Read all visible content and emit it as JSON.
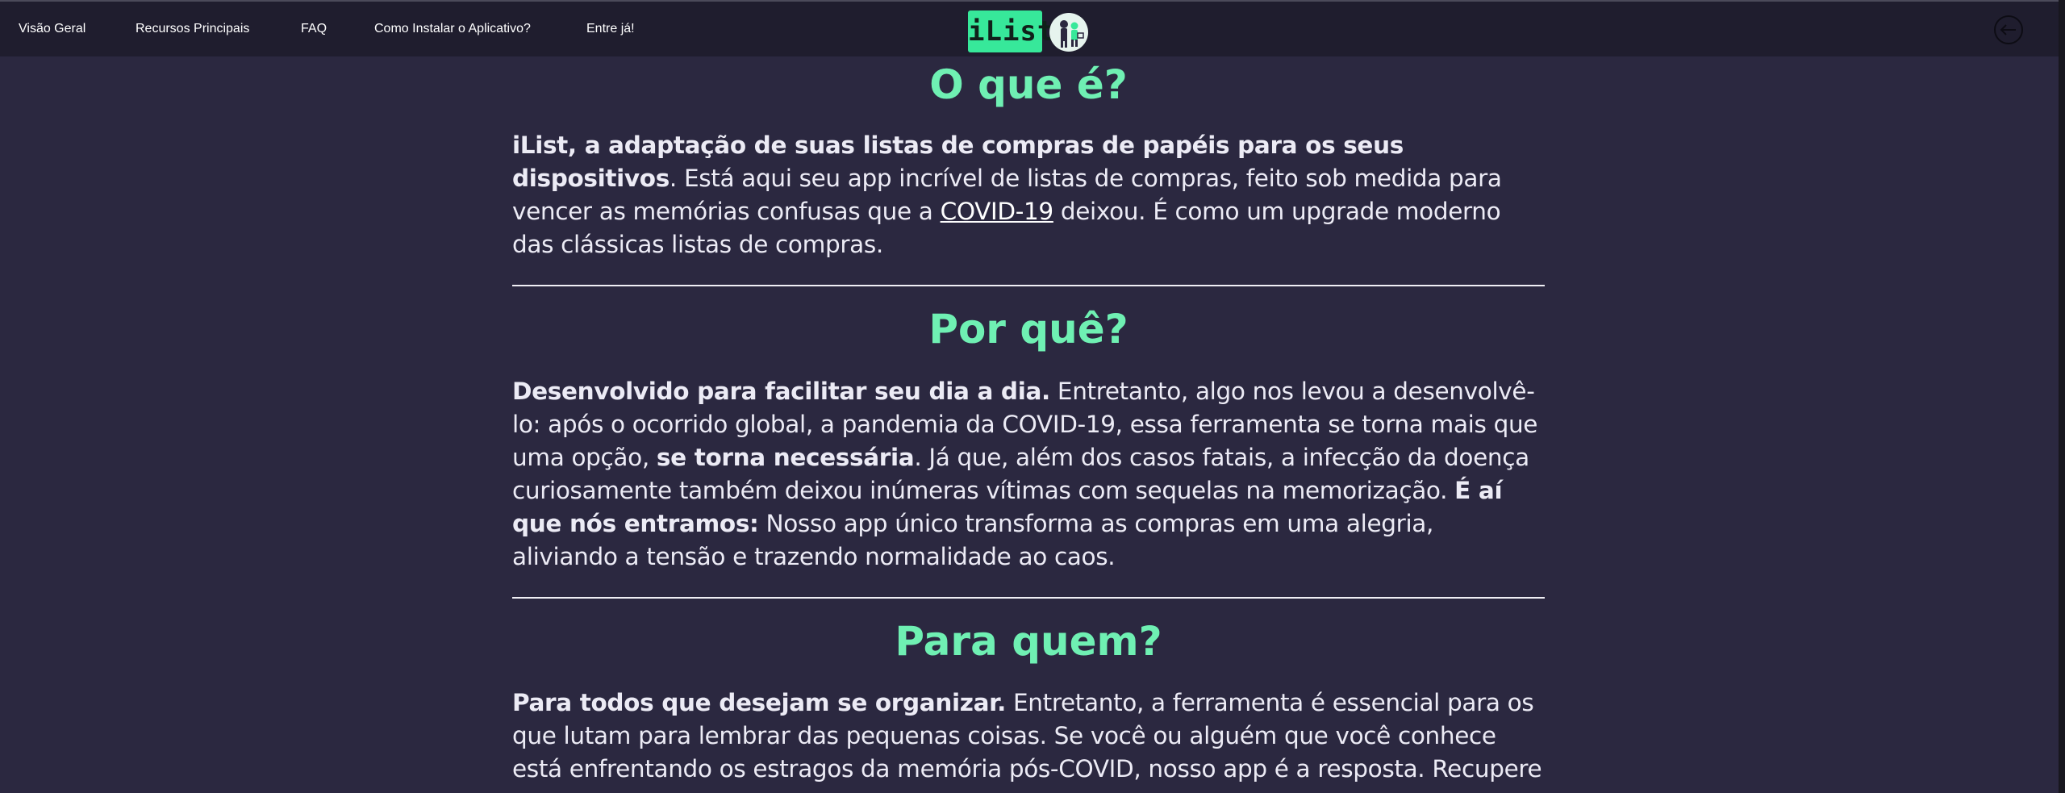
{
  "nav": {
    "items": [
      {
        "label": "Visão Geral"
      },
      {
        "label": "Recursos Principais"
      },
      {
        "label": "FAQ"
      },
      {
        "label": "Como Instalar o Aplicativo?"
      },
      {
        "label": "Entre já!"
      }
    ]
  },
  "brand": {
    "name": "iList",
    "logo_icon": "people-shopping-illustration-icon"
  },
  "back_icon": "arrow-left-circle-icon",
  "colors": {
    "background": "#2b2840",
    "topbar": "#1f1d2e",
    "accent": "#37e89a",
    "heading": "#6ff0b3"
  },
  "sections": [
    {
      "title": "O que é?",
      "p": [
        {
          "t": "iList, a adaptação de suas listas de compras de papéis para os seus dispositivos",
          "b": true
        },
        {
          "t": ". Está aqui seu app incrível de listas de compras, feito sob medida para vencer as memórias confusas que a "
        },
        {
          "t": "COVID-19",
          "link": true
        },
        {
          "t": " deixou. É como um upgrade moderno das clássicas listas de compras."
        }
      ]
    },
    {
      "title": "Por quê?",
      "p": [
        {
          "t": "Desenvolvido para facilitar seu dia a dia.",
          "b": true
        },
        {
          "t": " Entretanto, algo nos levou a desenvolvê-lo: após o ocorrido global, a pandemia da COVID-19, essa ferramenta se torna mais que uma opção, "
        },
        {
          "t": "se torna necessária",
          "b": true
        },
        {
          "t": ". Já que, além dos casos fatais, a infecção da doença curiosamente também deixou inúmeras vítimas com sequelas na memorização. "
        },
        {
          "t": "É aí que nós entramos:",
          "b": true
        },
        {
          "t": " Nosso app único transforma as compras em uma alegria, aliviando a tensão e trazendo normalidade ao caos."
        }
      ]
    },
    {
      "title": "Para quem?",
      "p": [
        {
          "t": "Para todos que desejam se organizar.",
          "b": true
        },
        {
          "t": " Entretanto, a ferramenta é essencial para os que lutam para lembrar das pequenas coisas. Se você ou alguém que você conhece está enfrentando os estragos da memória pós-COVID, nosso app é a resposta. Recupere sua"
        }
      ]
    }
  ]
}
